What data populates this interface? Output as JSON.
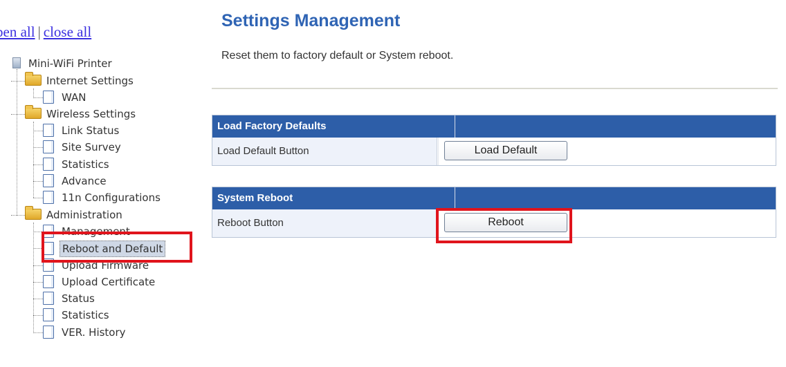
{
  "toplinks": {
    "open_all": "pen all",
    "separator": "|",
    "close_all": "close all"
  },
  "tree": {
    "root": "Mini-WiFi Printer",
    "internet_settings": {
      "label": "Internet Settings",
      "items": [
        "WAN"
      ]
    },
    "wireless_settings": {
      "label": "Wireless Settings",
      "items": [
        "Link Status",
        "Site Survey",
        "Statistics",
        "Advance",
        "11n Configurations"
      ]
    },
    "administration": {
      "label": "Administration",
      "items": [
        "Management",
        "Reboot and Default",
        "Upload Firmware",
        "Upload Certificate",
        "Status",
        "Statistics",
        "VER. History"
      ]
    },
    "selected": "Reboot and Default"
  },
  "main": {
    "title": "Settings Management",
    "description": "Reset them to factory default or System reboot.",
    "factory": {
      "header": "Load Factory Defaults",
      "row_label": "Load Default Button",
      "button": "Load Default"
    },
    "reboot": {
      "header": "System Reboot",
      "row_label": "Reboot Button",
      "button": "Reboot"
    }
  },
  "colors": {
    "header_bg": "#2d5ea8",
    "title": "#2f64b4",
    "highlight": "#e0141c",
    "link": "#3b2fe0"
  }
}
